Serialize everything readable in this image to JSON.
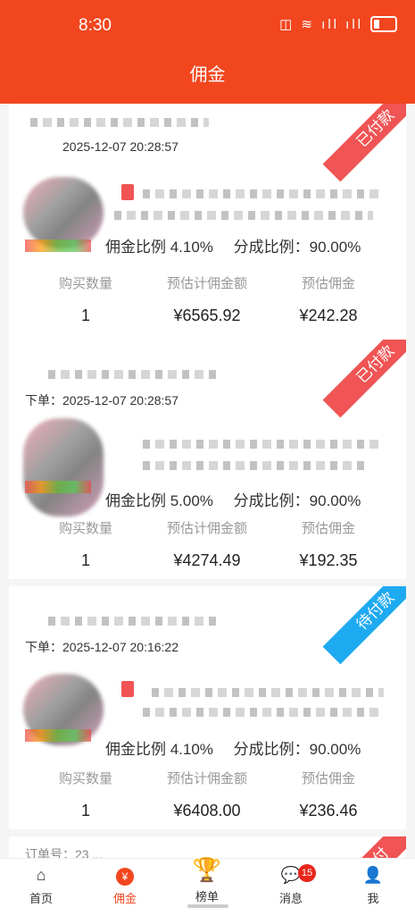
{
  "status_bar": {
    "time": "8:30",
    "icons": "◫ ≋ ıll ıll"
  },
  "header": {
    "title": "佣金"
  },
  "orders": [
    {
      "status": "已付款",
      "order_time": "2025-12-07 20:28:57",
      "commission_rate": "佣金比例 4.10%",
      "share_rate": "分成比例：90.00%",
      "quantity": "1",
      "estimated_amount": "¥6565.92",
      "estimated_commission": "¥242.28"
    },
    {
      "status": "已付款",
      "order_time": "下单：2025-12-07 20:28:57",
      "commission_rate": "佣金比例 5.00%",
      "share_rate": "分成比例：90.00%",
      "quantity": "1",
      "estimated_amount": "¥4274.49",
      "estimated_commission": "¥192.35"
    },
    {
      "status": "待付款",
      "order_time": "下单：2025-12-07 20:16:22",
      "commission_rate": "佣金比例 4.10%",
      "share_rate": "分成比例：90.00%",
      "quantity": "1",
      "estimated_amount": "¥6408.00",
      "estimated_commission": "¥236.46"
    }
  ],
  "partial_order": {
    "status": "已付",
    "text": "订单号：23 ..."
  },
  "stat_labels": {
    "quantity": "购买数量",
    "estimated_amount": "预估计佣金额",
    "estimated_commission": "预估佣金"
  },
  "tabbar": {
    "home": "首页",
    "commission": "佣金",
    "ranking": "榜单",
    "messages": "消息",
    "messages_badge": "15",
    "me": "我",
    "commission_icon": "¥"
  },
  "colors": {
    "brand": "#f2461f",
    "paid": "#f05454",
    "pending": "#1eaaf1"
  }
}
